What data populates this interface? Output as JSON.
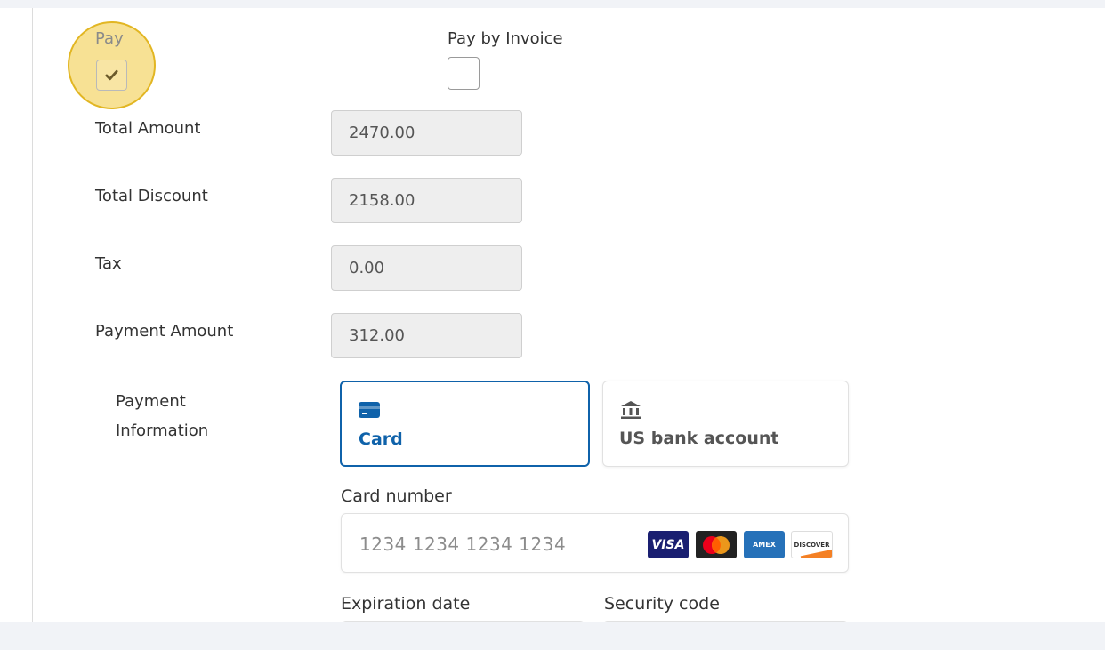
{
  "pay": {
    "label": "Pay",
    "checked": true
  },
  "invoice": {
    "label": "Pay by Invoice",
    "checked": false
  },
  "fields": [
    {
      "label": "Total Amount",
      "value": "2470.00"
    },
    {
      "label": "Total Discount",
      "value": "2158.00"
    },
    {
      "label": "Tax",
      "value": "0.00"
    },
    {
      "label": "Payment Amount",
      "value": "312.00"
    }
  ],
  "payment_info": {
    "label_line1": "Payment",
    "label_line2": "Information",
    "methods": [
      {
        "label": "Card",
        "icon": "credit-card-icon",
        "selected": true
      },
      {
        "label": "US bank account",
        "icon": "bank-icon",
        "selected": false
      }
    ],
    "card_number": {
      "label": "Card number",
      "placeholder": "1234 1234 1234 1234"
    },
    "card_brands": {
      "visa": "VISA",
      "amex": "AMEX",
      "discover": "DISCOVER"
    },
    "expiration": {
      "label": "Expiration date"
    },
    "security": {
      "label": "Security code"
    }
  },
  "colors": {
    "accent": "#0f62aa",
    "highlight": "#e2b623"
  }
}
